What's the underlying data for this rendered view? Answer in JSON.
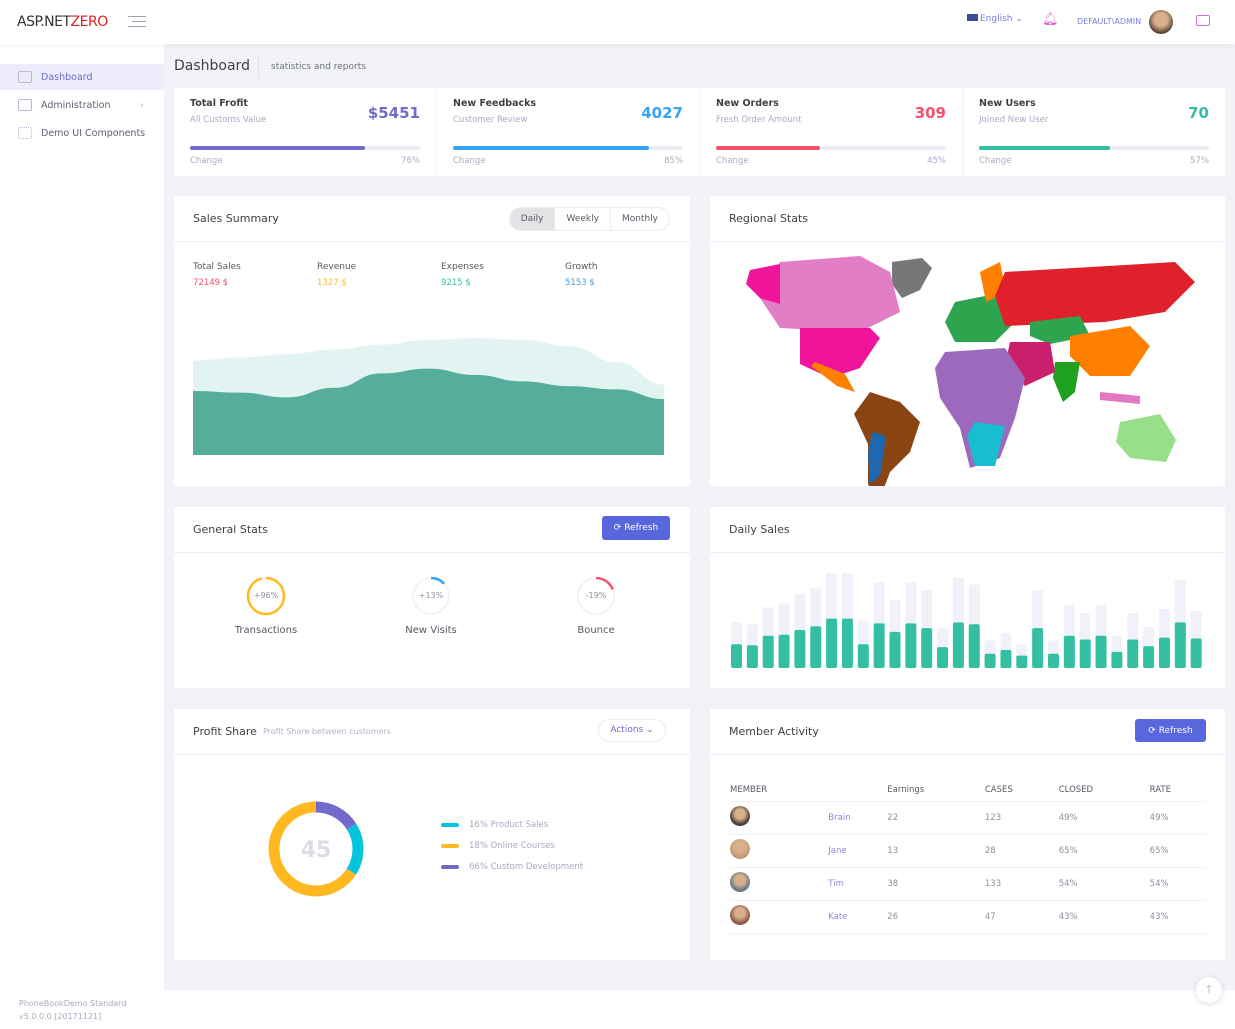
{
  "header": {
    "logo_text": "ASP.NET",
    "logo_accent": "ZERO",
    "language": "English",
    "user": "DEFAULT\\ADMIN"
  },
  "sidebar": {
    "items": [
      {
        "label": "Dashboard",
        "active": true
      },
      {
        "label": "Administration"
      },
      {
        "label": "Demo UI Components"
      }
    ]
  },
  "page": {
    "title": "Dashboard",
    "subtitle": "statistics and reports"
  },
  "stats": [
    {
      "title": "Total Frofit",
      "subtitle": "All Customs Value",
      "value": "$5451",
      "change_label": "Change",
      "change": "76%",
      "progress": 76,
      "color": "#716aca"
    },
    {
      "title": "New Feedbacks",
      "subtitle": "Customer Review",
      "value": "4027",
      "change_label": "Change",
      "change": "85%",
      "progress": 85,
      "color": "#36a3f7"
    },
    {
      "title": "New Orders",
      "subtitle": "Fresh Order Amount",
      "value": "309",
      "change_label": "Change",
      "change": "45%",
      "progress": 45,
      "color": "#f4516c"
    },
    {
      "title": "New Users",
      "subtitle": "Joined New User",
      "value": "70",
      "change_label": "Change",
      "change": "57%",
      "progress": 57,
      "color": "#34bfa3"
    }
  ],
  "sales_summary": {
    "title": "Sales Summary",
    "tabs": [
      "Daily",
      "Weekly",
      "Monthly"
    ],
    "active_tab": "Daily",
    "metrics": [
      {
        "label": "Total Sales",
        "value": "72149 $",
        "color": "#f4516c"
      },
      {
        "label": "Revenue",
        "value": "1327 $",
        "color": "#ffb822"
      },
      {
        "label": "Expenses",
        "value": "9215 $",
        "color": "#34bfa3"
      },
      {
        "label": "Growth",
        "value": "5153 $",
        "color": "#36a3f7"
      }
    ]
  },
  "regional": {
    "title": "Regional Stats"
  },
  "general_stats": {
    "title": "General Stats",
    "refresh_label": "Refresh",
    "gauges": [
      {
        "label": "Transactions",
        "value": "+96%",
        "percent": 96,
        "color": "#ffb822"
      },
      {
        "label": "New Visits",
        "value": "+13%",
        "percent": 13,
        "color": "#36a3f7"
      },
      {
        "label": "Bounce",
        "value": "-19%",
        "percent": 19,
        "color": "#f4516c"
      }
    ]
  },
  "daily_sales": {
    "title": "Daily Sales"
  },
  "profit_share": {
    "title": "Profit Share",
    "subtitle": "Profit Share between customers",
    "actions_label": "Actions",
    "center_value": "45",
    "legend": [
      {
        "label": "16% Product Sales",
        "color": "#00c5dc"
      },
      {
        "label": "18% Online Courses",
        "color": "#ffb822"
      },
      {
        "label": "66% Custom Development",
        "color": "#716aca"
      }
    ]
  },
  "member_activity": {
    "title": "Member Activity",
    "refresh_label": "Refresh",
    "columns": [
      "MEMBER",
      "",
      "Earnings",
      "CASES",
      "CLOSED",
      "RATE"
    ],
    "rows": [
      {
        "name": "Brain",
        "earnings": "22",
        "cases": "123",
        "closed": "49%",
        "rate": "49%"
      },
      {
        "name": "Jane",
        "earnings": "13",
        "cases": "28",
        "closed": "65%",
        "rate": "65%"
      },
      {
        "name": "Tim",
        "earnings": "38",
        "cases": "133",
        "closed": "54%",
        "rate": "54%"
      },
      {
        "name": "Kate",
        "earnings": "26",
        "cases": "47",
        "closed": "43%",
        "rate": "43%"
      }
    ]
  },
  "footer": {
    "line1": "PhoneBookDemo Standard",
    "line2": "v5.0.0.0 [20171121]"
  },
  "chart_data": [
    {
      "type": "area",
      "series": [
        {
          "values": [
            59,
            61,
            63,
            66,
            69,
            72,
            73,
            72,
            68,
            58,
            44
          ],
          "color": "#e2f4f1"
        },
        {
          "values": [
            40,
            39,
            36,
            42,
            51,
            54,
            50,
            46,
            43,
            41,
            35
          ],
          "color": "#56ad9c"
        }
      ]
    },
    {
      "type": "bar",
      "stacked": true,
      "series": [
        {
          "values": [
            25,
            24,
            34,
            35,
            40,
            44,
            52,
            52,
            25,
            47,
            38,
            47,
            42,
            22,
            48,
            46,
            15,
            19,
            13,
            42,
            15,
            34,
            30,
            34,
            17,
            30,
            23,
            32,
            48,
            31
          ],
          "color": "#34bfa3"
        },
        {
          "values": [
            48,
            46,
            64,
            68,
            78,
            84,
            100,
            100,
            50,
            90,
            72,
            90,
            82,
            42,
            95,
            88,
            29,
            37,
            25,
            82,
            29,
            66,
            58,
            66,
            34,
            58,
            43,
            62,
            93,
            60
          ],
          "color": "#f1f1fa"
        }
      ]
    },
    {
      "type": "pie",
      "donut": true,
      "segments": [
        {
          "value": 16,
          "color": "#716aca"
        },
        {
          "value": 18,
          "color": "#00c5dc"
        },
        {
          "value": 66,
          "color": "#ffb822"
        }
      ]
    }
  ]
}
